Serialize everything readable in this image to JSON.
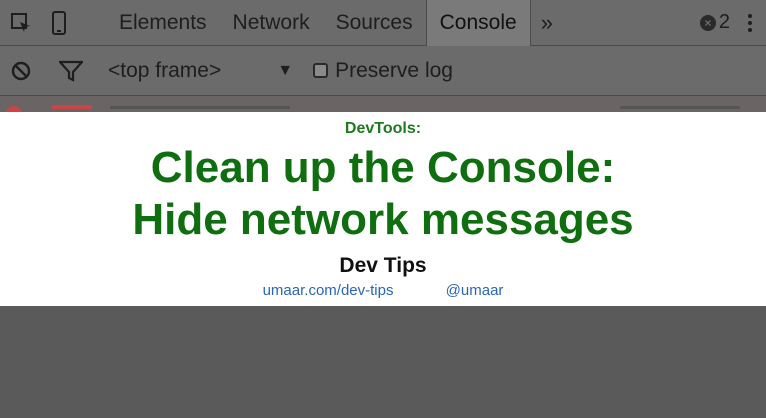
{
  "tabbar": {
    "tabs": [
      "Elements",
      "Network",
      "Sources",
      "Console"
    ],
    "active_tab": "Console",
    "more_label": "»",
    "error_count": "2",
    "error_icon_glyph": "×"
  },
  "toolbar": {
    "frame_selector": "<top frame>",
    "frame_caret": "▼",
    "preserve_log_label": "Preserve log"
  },
  "overlay": {
    "kicker": "DevTools:",
    "headline_line1": "Clean up the Console:",
    "headline_line2": "Hide network messages",
    "site_title": "Dev Tips",
    "link_site": "umaar.com/dev-tips",
    "link_handle": "@umaar"
  },
  "colors": {
    "headline": "#0f6e0f",
    "link": "#2a66b8",
    "chrome": "#6b6b6b"
  }
}
